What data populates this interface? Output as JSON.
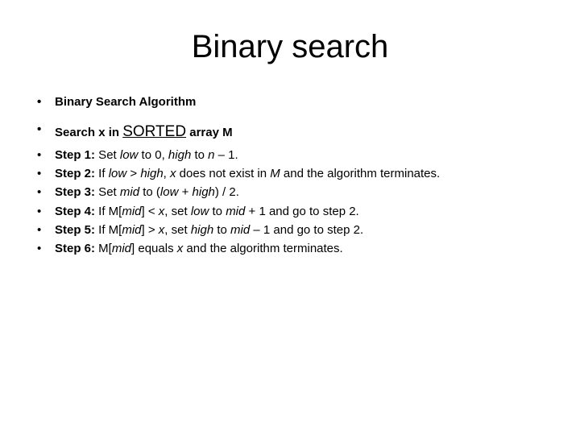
{
  "title": "Binary search",
  "heading": "Binary Search Algorithm",
  "subhead": {
    "pre": "Search x in ",
    "sorted": "SORTED",
    "post": " array M"
  },
  "steps": [
    {
      "label": "Step 1:",
      "pieces": [
        " Set ",
        {
          "it": "low"
        },
        " to 0, ",
        {
          "it": "high"
        },
        " to ",
        {
          "it": "n"
        },
        " – 1."
      ]
    },
    {
      "label": "Step 2:",
      "pieces": [
        " If ",
        {
          "it": "low"
        },
        " > ",
        {
          "it": "high"
        },
        ", ",
        {
          "it": "x"
        },
        " does not exist in ",
        {
          "it": "M"
        },
        " and the algorithm terminates."
      ]
    },
    {
      "label": "Step 3:",
      "pieces": [
        " Set ",
        {
          "it": "mid"
        },
        " to (",
        {
          "it": "low"
        },
        " + ",
        {
          "it": "high"
        },
        ") / 2."
      ]
    },
    {
      "label": "Step 4:",
      "pieces": [
        " If M[",
        {
          "it": "mid"
        },
        "] < ",
        {
          "it": "x"
        },
        ", set ",
        {
          "it": "low"
        },
        " to ",
        {
          "it": "mid"
        },
        " + 1 and go to step 2."
      ]
    },
    {
      "label": "Step 5:",
      "pieces": [
        " If M[",
        {
          "it": "mid"
        },
        "] > ",
        {
          "it": "x"
        },
        ", set ",
        {
          "it": "high"
        },
        " to ",
        {
          "it": "mid"
        },
        " – 1 and go to step 2."
      ]
    },
    {
      "label": "Step 6:",
      "pieces": [
        " M[",
        {
          "it": "mid"
        },
        "] equals ",
        {
          "it": "x"
        },
        " and the algorithm terminates."
      ]
    }
  ]
}
